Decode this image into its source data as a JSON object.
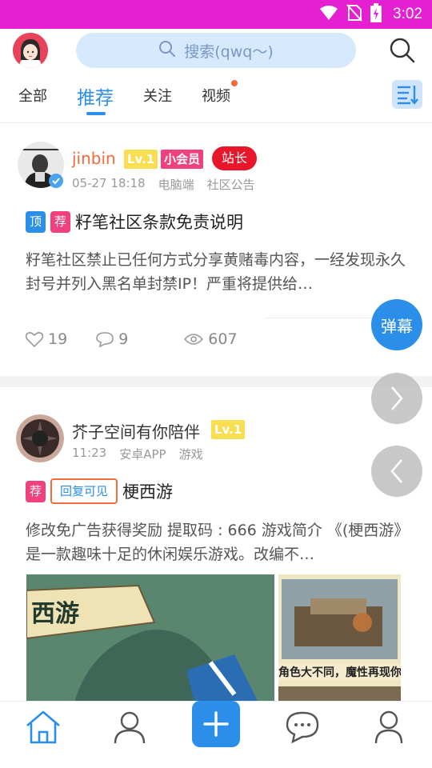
{
  "status_bar": {
    "time": "3:02"
  },
  "search": {
    "placeholder": "搜索(qwq～)"
  },
  "tabs": [
    {
      "label": "全部"
    },
    {
      "label": "推荐"
    },
    {
      "label": "关注"
    },
    {
      "label": "视频"
    }
  ],
  "posts": [
    {
      "author": "jinbin",
      "level": "Lv.1",
      "badge_vip": "小会员",
      "badge_role": "站长",
      "time": "05-27 18:18",
      "platform": "电脑端",
      "forum": "社区公告",
      "tags": [
        "顶",
        "荐"
      ],
      "title": "籽笔社区条款免责说明",
      "excerpt": "籽笔社区禁止已任何方式分享黄赌毒内容，一经发现永久封号并列入黑名单封禁IP！严重将提供给…",
      "likes": "19",
      "comments": "9",
      "views": "607"
    },
    {
      "author": "芥子空间有你陪伴",
      "level": "Lv.1",
      "time": "11:23",
      "platform": "安卓APP",
      "forum": "游戏",
      "tags": [
        "荐",
        "回复可见"
      ],
      "title": "梗西游",
      "excerpt": "修改免广告获得奖励 提取码 : 666 游戏简介 《(梗西游》是一款趣味十足的休闲娱乐游戏。改编不…",
      "image1_text": "西游",
      "image2_text": "角色大不同，魔性再现你眼前"
    }
  ],
  "floating": {
    "danmu": "弹幕"
  },
  "colors": {
    "accent": "#2b8ee8",
    "status_bar": "#e620d2",
    "name_orange": "#f26b3a",
    "tag_pink": "#f0407d"
  }
}
